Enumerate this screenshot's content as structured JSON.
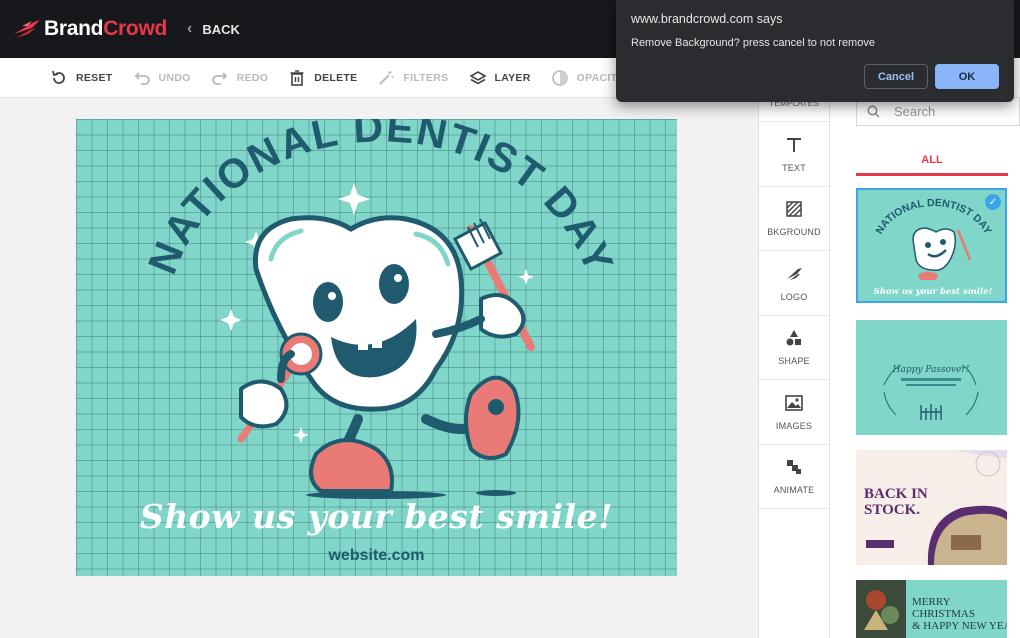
{
  "header": {
    "brand_part1": "Brand",
    "brand_part2": "Crowd",
    "back_label": "BACK"
  },
  "toolbar": {
    "items": [
      {
        "label": "RESET",
        "icon": "reset-icon",
        "enabled": true
      },
      {
        "label": "UNDO",
        "icon": "undo-icon",
        "enabled": false
      },
      {
        "label": "REDO",
        "icon": "redo-icon",
        "enabled": false
      },
      {
        "label": "DELETE",
        "icon": "trash-icon",
        "enabled": true
      },
      {
        "label": "FILTERS",
        "icon": "wand-icon",
        "enabled": false
      },
      {
        "label": "LAYER",
        "icon": "layers-icon",
        "enabled": true
      },
      {
        "label": "OPACITY",
        "icon": "opacity-icon",
        "enabled": false
      }
    ]
  },
  "design": {
    "headline": "NATIONAL DENTIST DAY",
    "tagline": "Show us your best smile!",
    "website": "website.com"
  },
  "side_tools": {
    "header": "TEMPLATES",
    "items": [
      {
        "label": "TEXT",
        "icon": "text-icon"
      },
      {
        "label": "BKGROUND",
        "icon": "background-icon"
      },
      {
        "label": "LOGO",
        "icon": "logo-icon"
      },
      {
        "label": "SHAPE",
        "icon": "shape-icon"
      },
      {
        "label": "IMAGES",
        "icon": "image-icon"
      },
      {
        "label": "ANIMATE",
        "icon": "animate-icon"
      }
    ]
  },
  "templates_panel": {
    "search_placeholder": "Search",
    "tab_all": "ALL",
    "thumbs": [
      {
        "title": "NATIONAL DENTIST DAY",
        "caption": "Show us your best smile!",
        "selected": true
      },
      {
        "title": "Happy Passover!",
        "selected": false
      },
      {
        "title": "BACK IN STOCK.",
        "selected": false
      },
      {
        "title": "MERRY CHRISTMAS & HAPPY NEW YEAR!",
        "selected": false
      }
    ]
  },
  "dialog": {
    "title": "www.brandcrowd.com says",
    "message": "Remove Background? press  cancel to not remove",
    "cancel_label": "Cancel",
    "ok_label": "OK"
  },
  "colors": {
    "brand_red": "#e8374a",
    "topbar": "#16181c",
    "design_bg": "#80d6c8",
    "design_dark": "#1f5a6e",
    "coral": "#ea7a75",
    "dialog_bg": "#2b2c30",
    "ok_button": "#8ab4f8"
  }
}
